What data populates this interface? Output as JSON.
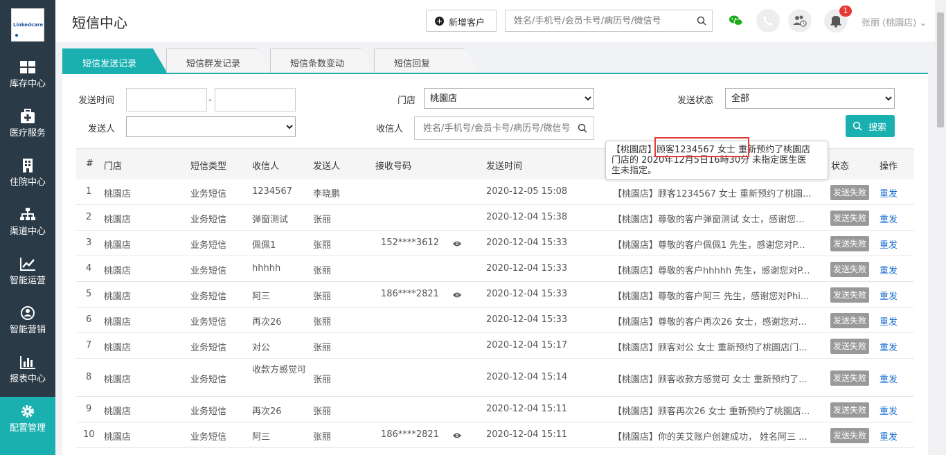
{
  "sidebar": {
    "logo_text": "Linkedcare",
    "items": [
      {
        "label": "库存中心",
        "icon": "grid-icon"
      },
      {
        "label": "医疗服务",
        "icon": "medkit-icon"
      },
      {
        "label": "住院中心",
        "icon": "building-icon"
      },
      {
        "label": "渠道中心",
        "icon": "hierarchy-icon"
      },
      {
        "label": "智能运营",
        "icon": "trend-chart-icon"
      },
      {
        "label": "智能营销",
        "icon": "marketing-icon"
      },
      {
        "label": "报表中心",
        "icon": "bar-chart-icon"
      },
      {
        "label": "配置管理",
        "icon": "gear-icon"
      }
    ]
  },
  "header": {
    "title": "短信中心",
    "add_customer": "新增客户",
    "search_placeholder": "姓名/手机号/会员卡号/病历号/微信号",
    "notification_count": "1",
    "user_name": "张丽 (桃園店) ⌄"
  },
  "tabs": [
    "短信发送记录",
    "短信群发记录",
    "短信条数变动",
    "短信回复"
  ],
  "filters": {
    "send_time_label": "发送时间",
    "date_sep": "-",
    "store_label": "门店",
    "store_value": "桃園店",
    "status_label": "发送状态",
    "status_value": "全部",
    "sender_label": "发送人",
    "recipient_label": "收信人",
    "recipient_placeholder": "姓名/手机号/会员卡号/病历号/微信号",
    "search_button": "搜索"
  },
  "table": {
    "headers": [
      "#",
      "门店",
      "短信类型",
      "收信人",
      "发送人",
      "接收号码",
      "发送时间",
      "状态",
      "操作"
    ],
    "rows": [
      {
        "n": "1",
        "store": "桃園店",
        "type": "业务短信",
        "recipient": "1234567",
        "sender": "李晓鹏",
        "phone": "",
        "time": "2020-12-05 15:08",
        "content": "【桃園店】顾客1234567 女士 重新预约了桃園...",
        "status": "发送失败",
        "action": "重发"
      },
      {
        "n": "2",
        "store": "桃園店",
        "type": "业务短信",
        "recipient": "弹窗测试",
        "sender": "张丽",
        "phone": "",
        "time": "2020-12-04 15:38",
        "content": "【桃園店】尊敬的客户弹窗测试 女士，感谢您...",
        "status": "发送失败",
        "action": "重发"
      },
      {
        "n": "3",
        "store": "桃園店",
        "type": "业务短信",
        "recipient": "佩佩1",
        "sender": "张丽",
        "phone": "152****3612",
        "time": "2020-12-04 15:33",
        "content": "【桃園店】尊敬的客户佩佩1 先生，感谢您对P...",
        "status": "发送失败",
        "action": "重发"
      },
      {
        "n": "4",
        "store": "桃園店",
        "type": "业务短信",
        "recipient": "hhhhh",
        "sender": "张丽",
        "phone": "",
        "time": "2020-12-04 15:33",
        "content": "【桃園店】尊敬的客户hhhhh 先生，感谢您对P...",
        "status": "发送失败",
        "action": "重发"
      },
      {
        "n": "5",
        "store": "桃園店",
        "type": "业务短信",
        "recipient": "阿三",
        "sender": "张丽",
        "phone": "186****2821",
        "time": "2020-12-04 15:33",
        "content": "【桃園店】尊敬的客户阿三 先生，感谢您对Phi...",
        "status": "发送失败",
        "action": "重发"
      },
      {
        "n": "6",
        "store": "桃園店",
        "type": "业务短信",
        "recipient": "再次26",
        "sender": "张丽",
        "phone": "",
        "time": "2020-12-04 15:33",
        "content": "【桃園店】尊敬的客户再次26 女士，感谢您对...",
        "status": "发送失败",
        "action": "重发"
      },
      {
        "n": "7",
        "store": "桃園店",
        "type": "业务短信",
        "recipient": "对公",
        "sender": "张丽",
        "phone": "",
        "time": "2020-12-04 15:17",
        "content": "【桃園店】顾客对公 女士 重新预约了桃園店门...",
        "status": "发送失败",
        "action": "重发"
      },
      {
        "n": "8",
        "store": "桃園店",
        "type": "业务短信",
        "recipient": "收款方感觉可",
        "sender": "张丽",
        "phone": "",
        "time": "2020-12-04 15:14",
        "content": "【桃園店】顾客收款方感觉可 女士 重新预约了...",
        "status": "发送失败",
        "action": "重发"
      },
      {
        "n": "9",
        "store": "桃園店",
        "type": "业务短信",
        "recipient": "再次26",
        "sender": "张丽",
        "phone": "",
        "time": "2020-12-04 15:11",
        "content": "【桃園店】顾客再次26 女士 重新预约了桃園店...",
        "status": "发送失败",
        "action": "重发"
      },
      {
        "n": "10",
        "store": "桃園店",
        "type": "业务短信",
        "recipient": "阿三",
        "sender": "张丽",
        "phone": "186****2821",
        "time": "2020-12-04 15:11",
        "content": "【桃園店】你的芙艾账户创建成功， 姓名阿三 ...",
        "status": "发送失败",
        "action": "重发"
      }
    ]
  },
  "tooltip": {
    "line1": "【桃園店】顾客1234567 女士 重新预约了桃園店",
    "line2": "门店的 2020年12月5日16時30分 未指定医生医",
    "line3": "生未指定。"
  },
  "colors": {
    "accent": "#1ab0b0",
    "sidebar": "#2b3a47",
    "link": "#1a6fd1",
    "badge": "#e53935"
  }
}
